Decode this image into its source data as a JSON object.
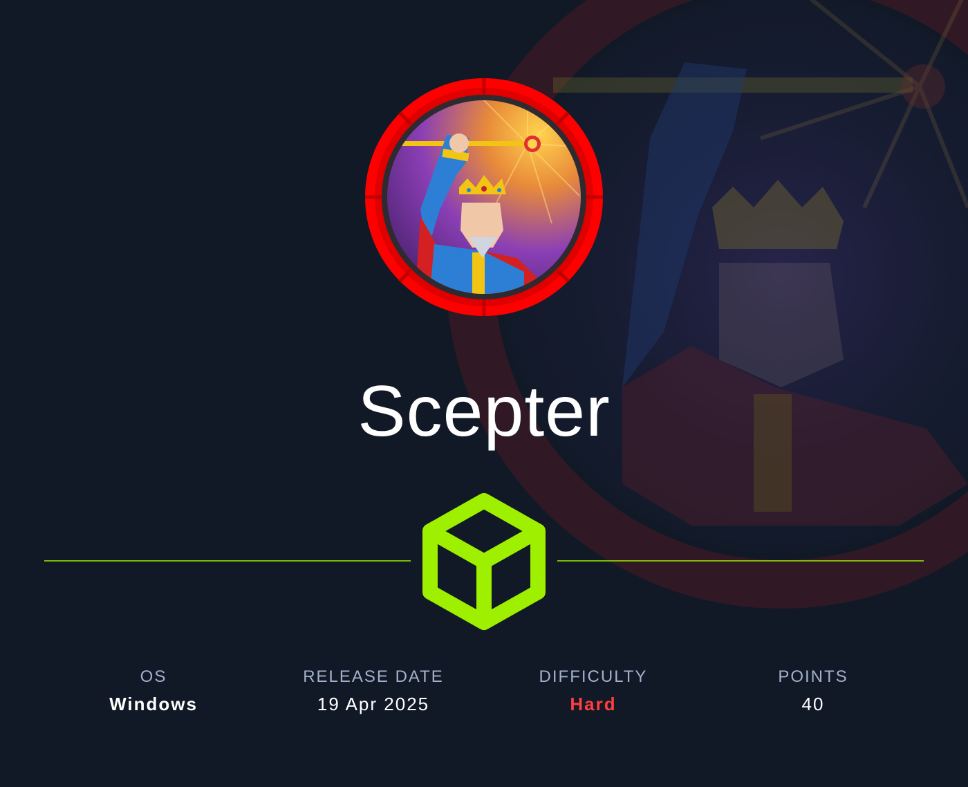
{
  "machine": {
    "name": "Scepter",
    "avatar_icon": "king-with-scepter-icon",
    "os_icon": "hackthebox-cube-icon"
  },
  "stats": [
    {
      "label": "OS",
      "value": "Windows"
    },
    {
      "label": "RELEASE DATE",
      "value": "19 Apr 2025"
    },
    {
      "label": "DIFFICULTY",
      "value": "Hard"
    },
    {
      "label": "POINTS",
      "value": "40"
    }
  ],
  "colors": {
    "background": "#111927",
    "accent_green": "#9fef00",
    "difficulty_hard": "#ff3e3e",
    "label": "#a4b1cd",
    "ring_red": "#ff0000"
  }
}
